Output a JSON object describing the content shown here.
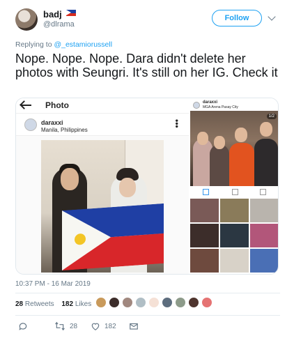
{
  "author": {
    "name": "badj",
    "handle": "@dlrama",
    "avatar_icon": "avatar-photo",
    "flag_icon": "philippines-flag-icon"
  },
  "follow_label": "Follow",
  "reply": {
    "prefix": "Replying to",
    "user": "@_estamiorussell"
  },
  "text": "Nope. Nope. Nope. Dara didn't delete her photos with Seungri. It's still on her IG. Check it",
  "media": {
    "screen_title": "Photo",
    "post_user": "daraxxi",
    "post_location": "Manila, Philippines",
    "right_user": "daraxxi",
    "right_location": "MGA Arena Pasay City",
    "counter": "1/2"
  },
  "timestamp": "10:37 PM - 16 Mar 2019",
  "stats": {
    "retweets_count": "28",
    "retweets_label": "Retweets",
    "likes_count": "182",
    "likes_label": "Likes"
  },
  "actions": {
    "reply_icon": "reply-icon",
    "retweet_icon": "retweet-icon",
    "retweet_count": "28",
    "like_icon": "heart-icon",
    "like_count": "182",
    "dm_icon": "envelope-icon"
  },
  "colors": {
    "accent": "#1da1f2",
    "muted": "#657786",
    "text": "#14171a"
  }
}
